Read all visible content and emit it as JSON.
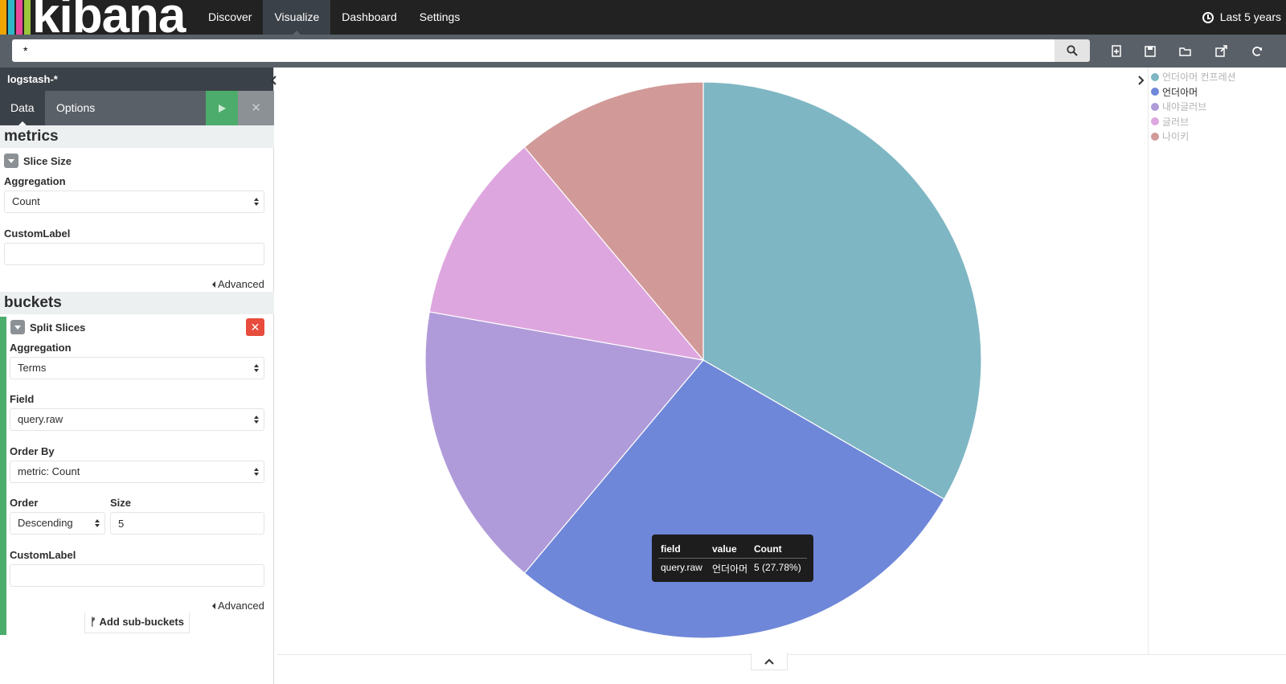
{
  "app": {
    "name": "kibana",
    "logo_colors": [
      "#f0a400",
      "#2eb7c7",
      "#e8479a",
      "#9bc53a"
    ]
  },
  "nav": {
    "items": [
      {
        "label": "Discover"
      },
      {
        "label": "Visualize"
      },
      {
        "label": "Dashboard"
      },
      {
        "label": "Settings"
      }
    ],
    "active": "Visualize",
    "time_range": "Last 5 years"
  },
  "search": {
    "value": "*",
    "placeholder": ""
  },
  "toolbar": {
    "icons": [
      "new-visualization-icon",
      "save-icon",
      "open-folder-icon",
      "share-icon",
      "refresh-icon"
    ]
  },
  "sidebar": {
    "index_pattern": "logstash-*",
    "tabs": [
      {
        "label": "Data"
      },
      {
        "label": "Options"
      }
    ],
    "apply_icon": "play-icon",
    "discard_glyph": "✕",
    "metrics": {
      "heading": "metrics",
      "agg_title": "Slice Size",
      "aggregation_label": "Aggregation",
      "aggregation_value": "Count",
      "custom_label_label": "CustomLabel",
      "custom_label_value": "",
      "advanced_label": "Advanced"
    },
    "buckets": {
      "heading": "buckets",
      "agg_title": "Split Slices",
      "remove_glyph": "✕",
      "aggregation_label": "Aggregation",
      "aggregation_value": "Terms",
      "field_label": "Field",
      "field_value": "query.raw",
      "order_by_label": "Order By",
      "order_by_value": "metric: Count",
      "order_label": "Order",
      "order_value": "Descending",
      "size_label": "Size",
      "size_value": "5",
      "custom_label_label": "CustomLabel",
      "custom_label_value": "",
      "advanced_label": "Advanced",
      "add_sub_buckets": "Add sub-buckets"
    }
  },
  "chart_data": {
    "type": "pie",
    "categories": [
      "언더아머 컨프레션",
      "언더아머",
      "내야글러브",
      "글러브",
      "나이키"
    ],
    "values": [
      6,
      5,
      3,
      2,
      2
    ],
    "colors": [
      "#7fb6c3",
      "#6f87d8",
      "#b09bda",
      "#dea6df",
      "#d19a98"
    ]
  },
  "legend": {
    "items": [
      {
        "label": "언더아머 컨프레션",
        "color": "#7fb6c3",
        "highlighted": false
      },
      {
        "label": "언더아머",
        "color": "#6f87d8",
        "highlighted": true
      },
      {
        "label": "내야글러브",
        "color": "#b09bda",
        "highlighted": false
      },
      {
        "label": "글러브",
        "color": "#dea6df",
        "highlighted": false
      },
      {
        "label": "나이키",
        "color": "#d19a98",
        "highlighted": false
      }
    ]
  },
  "tooltip": {
    "headers": {
      "field": "field",
      "value": "value",
      "count": "Count"
    },
    "row": {
      "field": "query.raw",
      "value": "언더아머",
      "count": "5 (27.78%)"
    }
  }
}
